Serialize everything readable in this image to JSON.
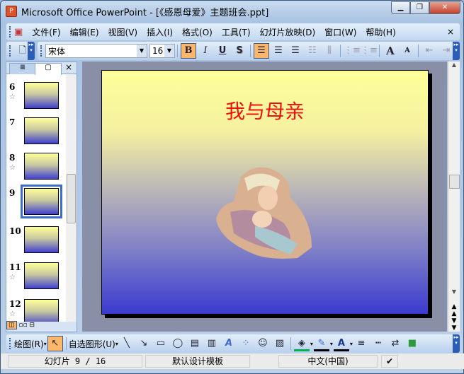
{
  "window": {
    "title": "Microsoft Office PowerPoint - [《感恩母爱》主题班会.ppt]",
    "minimize": "▁",
    "restore": "❐",
    "close": "✕"
  },
  "menu": [
    "文件(F)",
    "编辑(E)",
    "视图(V)",
    "插入(I)",
    "格式(O)",
    "工具(T)",
    "幻灯片放映(D)",
    "窗口(W)",
    "帮助(H)"
  ],
  "menu_close": "×",
  "toolbar": {
    "font": "宋体",
    "size": "16",
    "bold": "B",
    "italic": "I",
    "underline": "U",
    "shadow": "S",
    "grow": "A",
    "shrink": "A"
  },
  "panel": {
    "close": "×",
    "slides": [
      {
        "num": "6",
        "star": "☆"
      },
      {
        "num": "7",
        "star": ""
      },
      {
        "num": "8",
        "star": "☆"
      },
      {
        "num": "9",
        "star": "",
        "current": true
      },
      {
        "num": "10",
        "star": ""
      },
      {
        "num": "11",
        "star": "☆"
      },
      {
        "num": "12",
        "star": "☆"
      }
    ]
  },
  "slide": {
    "title": "我与母亲"
  },
  "drawing": {
    "draw_menu": "绘图(R)",
    "autoshapes": "自选图形(U)"
  },
  "status": {
    "slide": "幻灯片 9 / 16",
    "template": "默认设计模板",
    "language": "中文(中国)"
  },
  "colors": {
    "title_red": "#f01010",
    "fill_green": "#00b050"
  }
}
